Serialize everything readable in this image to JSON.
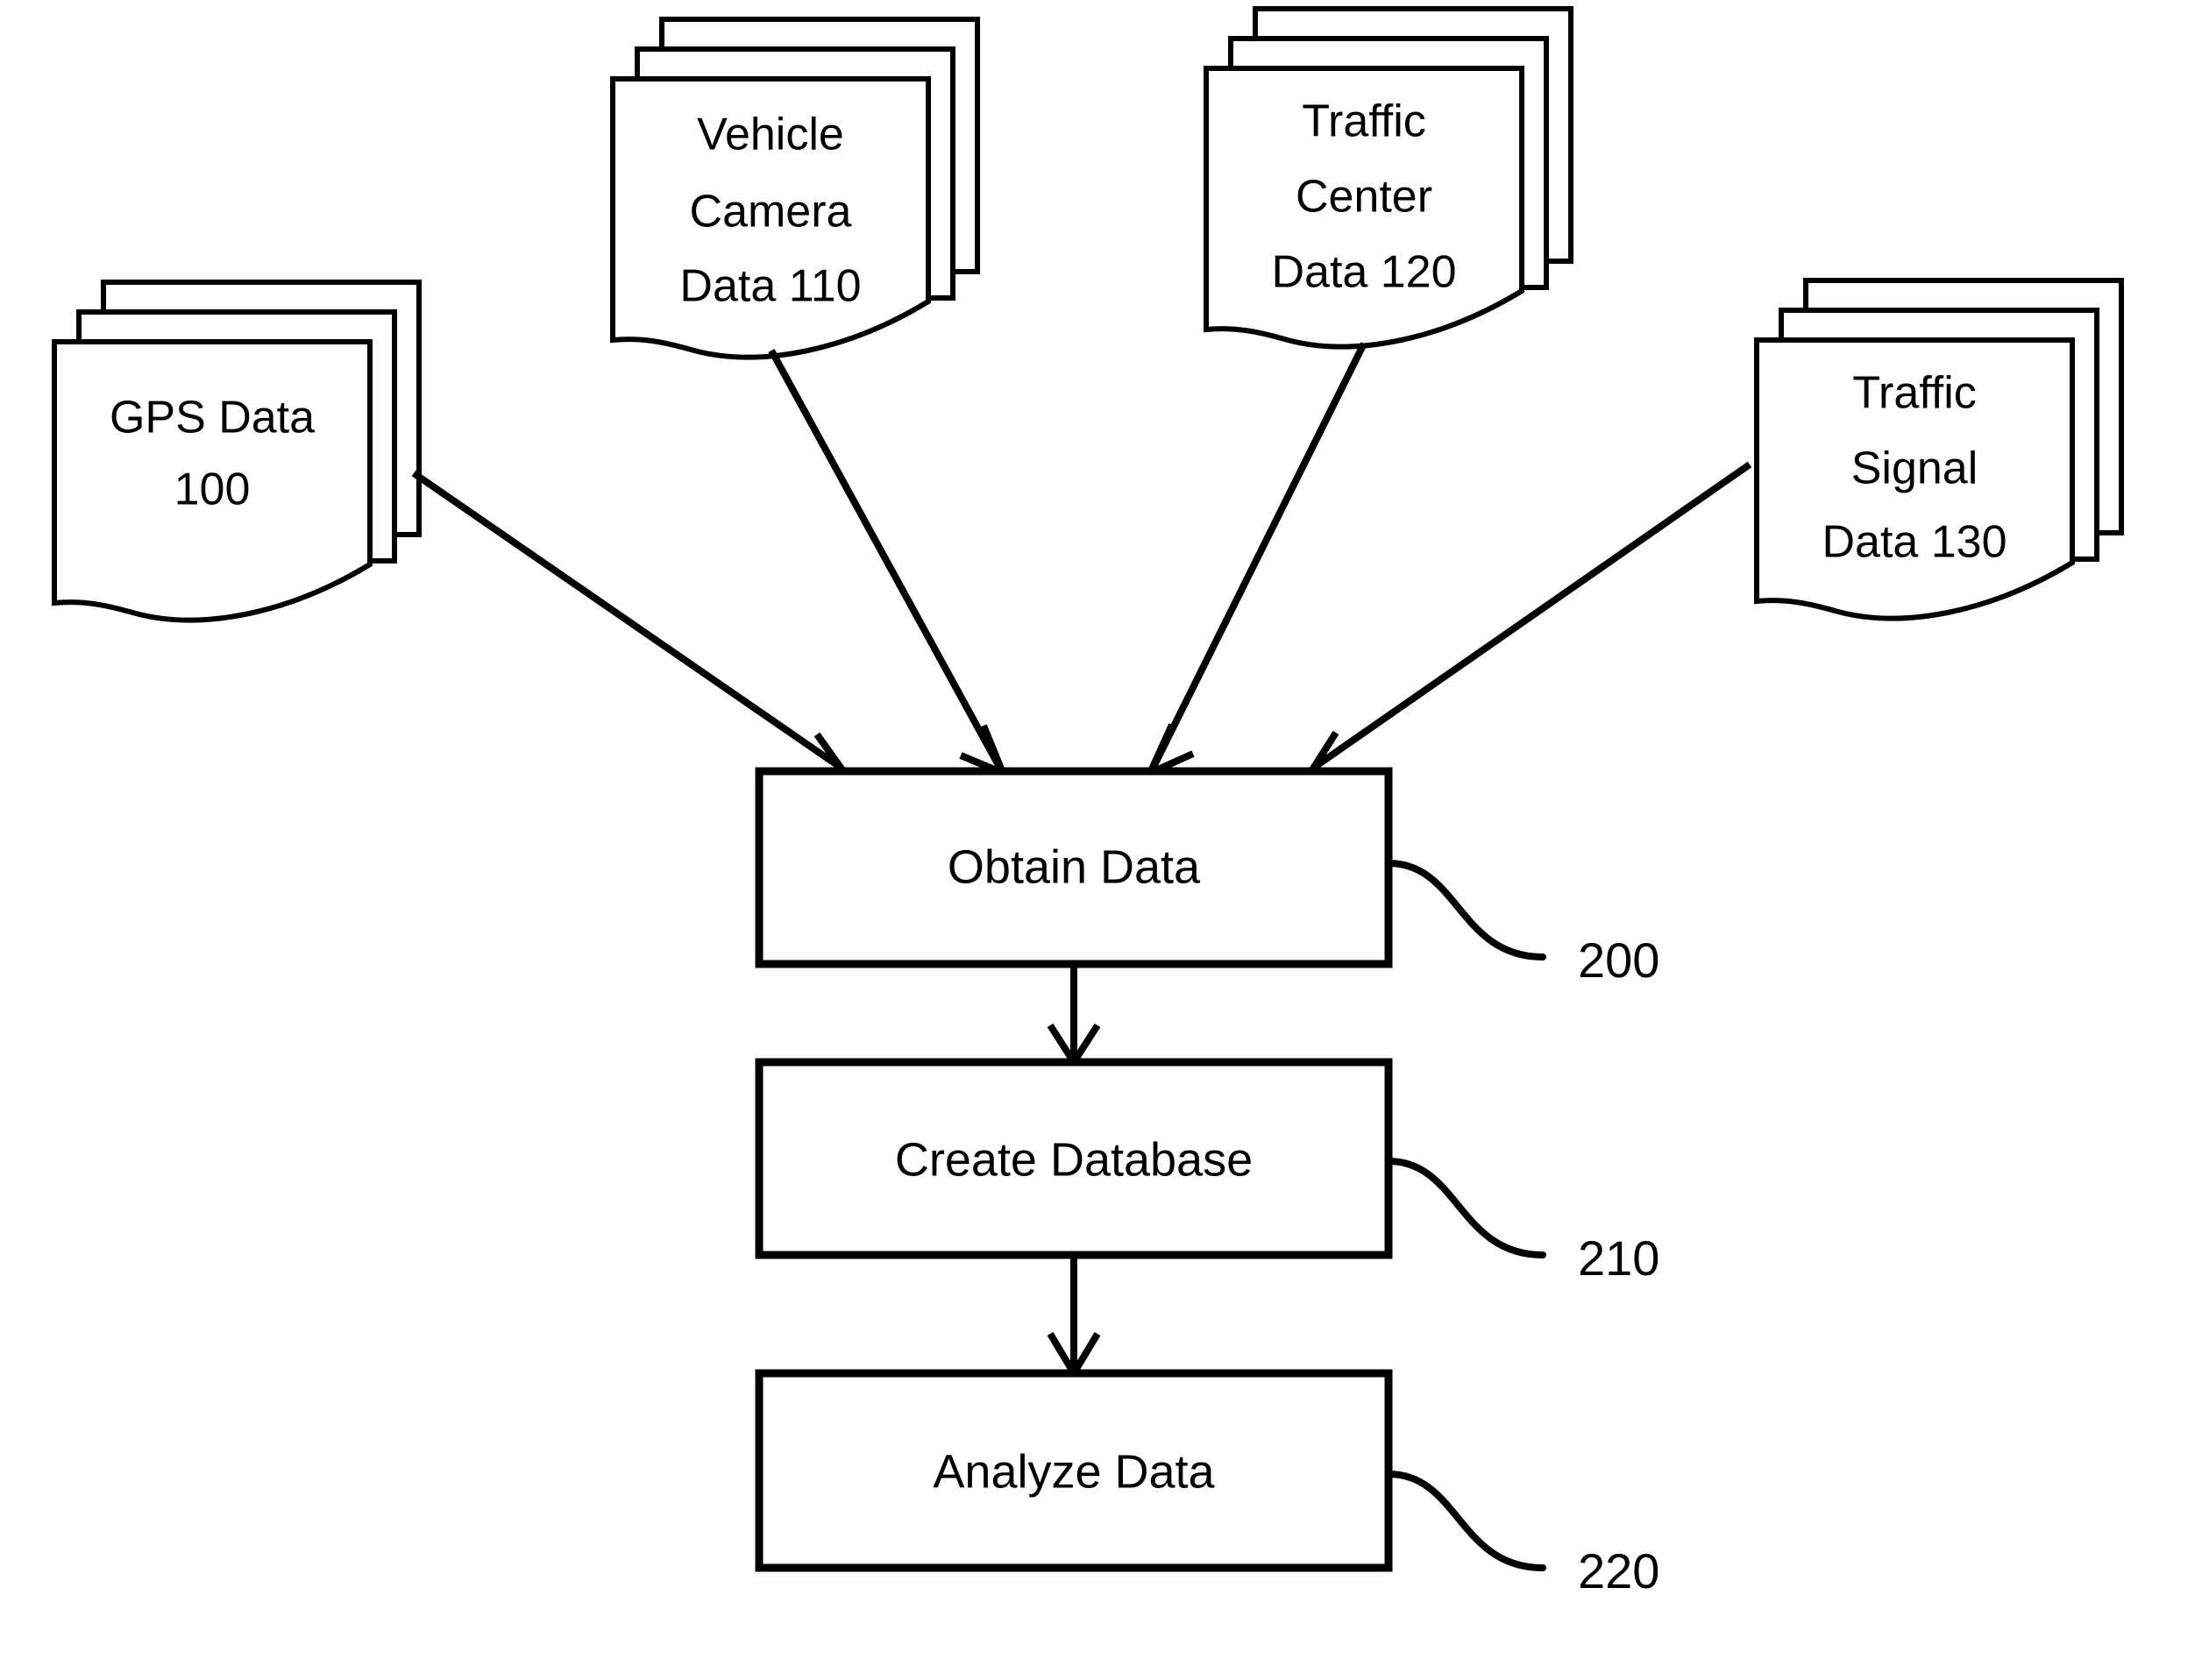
{
  "figure": {
    "kind": "patent-flowchart",
    "background_color": "#ffffff",
    "line_color": "#000000"
  },
  "sources": [
    {
      "id": "gps-data",
      "lines": [
        "GPS Data",
        "100"
      ],
      "line1": "GPS Data",
      "line2": "100",
      "line3": "",
      "ref": "100"
    },
    {
      "id": "vehicle-camera-data",
      "lines": [
        "Vehicle",
        "Camera",
        "Data 110"
      ],
      "line1": "Vehicle",
      "line2": "Camera",
      "line3": "Data 110",
      "ref": "110"
    },
    {
      "id": "traffic-center-data",
      "lines": [
        "Traffic",
        "Center",
        "Data 120"
      ],
      "line1": "Traffic",
      "line2": "Center",
      "line3": "Data 120",
      "ref": "120"
    },
    {
      "id": "traffic-signal-data",
      "lines": [
        "Traffic",
        "Signal",
        "Data 130"
      ],
      "line1": "Traffic",
      "line2": "Signal",
      "line3": "Data 130",
      "ref": "130"
    }
  ],
  "steps": [
    {
      "id": "obtain-data",
      "label": "Obtain Data",
      "ref": "200"
    },
    {
      "id": "create-database",
      "label": "Create Database",
      "ref": "210"
    },
    {
      "id": "analyze-data",
      "label": "Analyze Data",
      "ref": "220"
    }
  ],
  "refs": {
    "obtain": "200",
    "create": "210",
    "analyze": "220"
  }
}
